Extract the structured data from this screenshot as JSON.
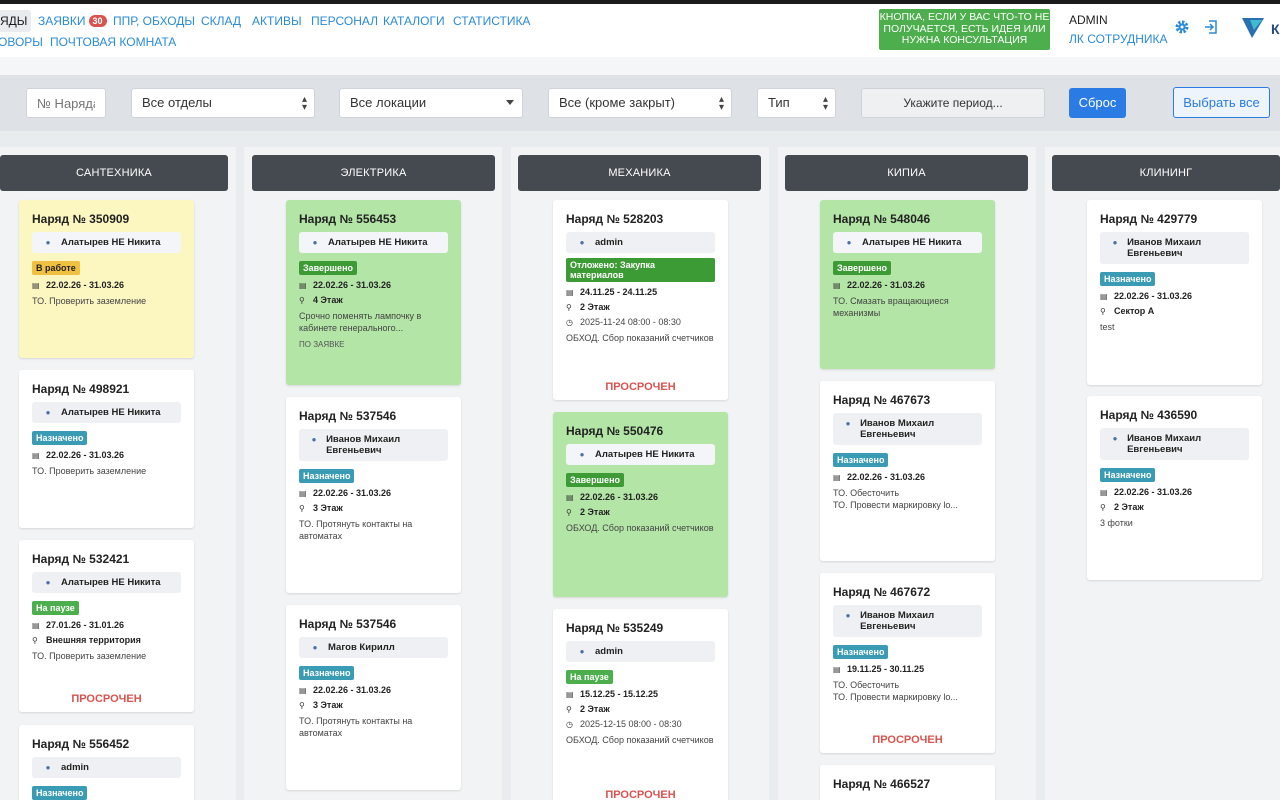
{
  "nav": {
    "items": [
      {
        "label": "ЯДЫ",
        "active": true
      },
      {
        "label": "ЗАЯВКИ",
        "badge": "30"
      },
      {
        "label": "ППР, ОБХОДЫ"
      },
      {
        "label": "СКЛАД"
      },
      {
        "label": "АКТИВЫ"
      },
      {
        "label": "ПЕРСОНАЛ"
      },
      {
        "label": "КАТАЛОГИ"
      },
      {
        "label": "СТАТИСТИКА"
      },
      {
        "label": "ОВОРЫ"
      },
      {
        "label": "ПОЧТОВАЯ КОМНАТА"
      }
    ]
  },
  "header": {
    "help_button": "КНОПКА, ЕСЛИ У ВАС ЧТО-ТО НЕ ПОЛУЧАЕТСЯ, ЕСТЬ ИДЕЯ ИЛИ НУЖНА КОНСУЛЬТАЦИЯ",
    "user": "ADMIN",
    "lk_link": "ЛК СОТРУДНИКА",
    "icons": [
      "gear-icon",
      "logout-icon",
      "logo"
    ],
    "logo_letter": "К"
  },
  "filters": {
    "order_number_placeholder": "№ Наряда",
    "departments": "Все отделы",
    "locations": "Все локации",
    "status": "Все (кроме закрыт)",
    "type": "Тип",
    "period": "Укажите период...",
    "reset": "Сброс",
    "select_all": "Выбрать все"
  },
  "colors": {
    "accent": "#2a7be4",
    "column_header": "#454a50",
    "card_yellow": "#fcf6c1",
    "card_green": "#b3e5a6",
    "overdue": "#d9534f"
  },
  "columns": [
    {
      "title": "САНТЕХНИКА",
      "cards": [
        {
          "title": "Наряд № 350909",
          "assignee": "Алатырев НЕ Никита",
          "status": "В работе",
          "dates": "22.02.26 - 31.03.26",
          "desc": "ТО. Проверить заземление"
        },
        {
          "title": "Наряд № 498921",
          "assignee": "Алатырев НЕ Никита",
          "status": "Назначено",
          "dates": "22.02.26 - 31.03.26",
          "desc": "ТО. Проверить заземление"
        },
        {
          "title": "Наряд № 532421",
          "assignee": "Алатырев НЕ Никита",
          "status": "На паузе",
          "dates": "27.01.26 - 31.01.26",
          "location": "Внешняя территория",
          "desc": "ТО. Проверить заземление",
          "overdue": "ПРОСРОЧЕН"
        },
        {
          "title": "Наряд № 556452",
          "assignee": "admin",
          "status": "Назначено"
        }
      ]
    },
    {
      "title": "ЭЛЕКТРИКА",
      "cards": [
        {
          "title": "Наряд № 556453",
          "assignee": "Алатырев НЕ Никита",
          "status": "Завершено",
          "dates": "22.02.26 - 31.03.26",
          "location": "4 Этаж",
          "desc": "Срочно поменять лампочку в кабинете генерального...",
          "tag": "ПО ЗАЯВКЕ"
        },
        {
          "title": "Наряд № 537546",
          "assignee": "Иванов Михаил Евгеньевич",
          "status": "Назначено",
          "dates": "22.02.26 - 31.03.26",
          "location": "3 Этаж",
          "desc": "ТО. Протянуть контакты на автоматах"
        },
        {
          "title": "Наряд № 537546",
          "assignee": "Магов Кирилл",
          "status": "Назначено",
          "dates": "22.02.26 - 31.03.26",
          "location": "3 Этаж",
          "desc": "ТО. Протянуть контакты на автоматах"
        }
      ]
    },
    {
      "title": "МЕХАНИКА",
      "cards": [
        {
          "title": "Наряд № 528203",
          "assignee": "admin",
          "status": "Отложено: Закупка материалов",
          "dates": "24.11.25 - 24.11.25",
          "location": "2 Этаж",
          "time": "2025-11-24 08:00 - 08:30",
          "desc": "ОБХОД. Сбор показаний счетчиков",
          "overdue": "ПРОСРОЧЕН"
        },
        {
          "title": "Наряд № 550476",
          "assignee": "Алатырев НЕ Никита",
          "status": "Завершено",
          "dates": "22.02.26 - 31.03.26",
          "location": "2 Этаж",
          "desc": "ОБХОД. Сбор показаний счетчиков"
        },
        {
          "title": "Наряд № 535249",
          "assignee": "admin",
          "status": "На паузе",
          "dates": "15.12.25 - 15.12.25",
          "location": "2 Этаж",
          "time": "2025-12-15 08:00 - 08:30",
          "desc": "ОБХОД. Сбор показаний счетчиков",
          "overdue": "ПРОСРОЧЕН"
        }
      ]
    },
    {
      "title": "КИПИА",
      "cards": [
        {
          "title": "Наряд № 548046",
          "assignee": "Алатырев НЕ Никита",
          "status": "Завершено",
          "dates": "22.02.26 - 31.03.26",
          "desc": "ТО. Смазать вращающиеся механизмы"
        },
        {
          "title": "Наряд № 467673",
          "assignee": "Иванов Михаил Евгеньевич",
          "status": "Назначено",
          "dates": "22.02.26 - 31.03.26",
          "desc": "ТО. Обесточить",
          "desc2": "ТО. Провести маркировку lo..."
        },
        {
          "title": "Наряд № 467672",
          "assignee": "Иванов Михаил Евгеньевич",
          "status": "Назначено",
          "dates": "19.11.25 - 30.11.25",
          "desc": "ТО. Обесточить",
          "desc2": "ТО. Провести маркировку lo...",
          "overdue": "ПРОСРОЧЕН"
        },
        {
          "title": "Наряд № 466527"
        }
      ]
    },
    {
      "title": "КЛИНИНГ",
      "cards": [
        {
          "title": "Наряд № 429779",
          "assignee": "Иванов Михаил Евгеньевич",
          "status": "Назначено",
          "dates": "22.02.26 - 31.03.26",
          "location": "Сектор А",
          "desc": "test"
        },
        {
          "title": "Наряд № 436590",
          "assignee": "Иванов Михаил Евгеньевич",
          "status": "Назначено",
          "dates": "22.02.26 - 31.03.26",
          "location": "2 Этаж",
          "desc": "3 фотки"
        }
      ]
    }
  ]
}
